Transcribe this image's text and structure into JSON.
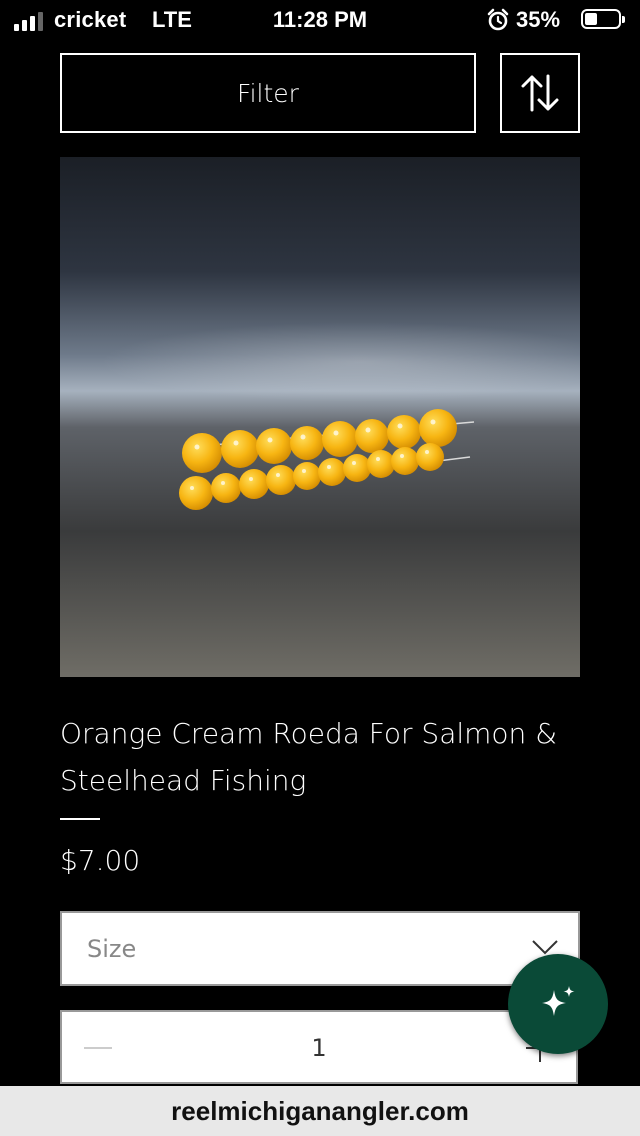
{
  "status_bar": {
    "carrier": "cricket",
    "network": "LTE",
    "time": "11:28 PM",
    "battery_percent": "35%",
    "battery_level": 0.35,
    "signal_bars": 3,
    "icons": [
      "signal-icon",
      "alarm-icon",
      "battery-icon"
    ]
  },
  "toolbar": {
    "filter_label": "Filter",
    "sort_icon": "sort-arrows-icon"
  },
  "product": {
    "title": "Orange Cream Roeda For Salmon & Steelhead Fishing",
    "price": "$7.00",
    "image_subject": "orange beads",
    "size_select": {
      "placeholder": "Size",
      "icon": "chevron-down-icon"
    },
    "quantity": {
      "value": "1",
      "decrement_icon": "minus-icon",
      "increment_icon": "plus-icon"
    }
  },
  "assistant": {
    "icon": "sparkle-icon",
    "color": "#0a4a37"
  },
  "browser": {
    "url": "reelmichiganangler.com"
  }
}
